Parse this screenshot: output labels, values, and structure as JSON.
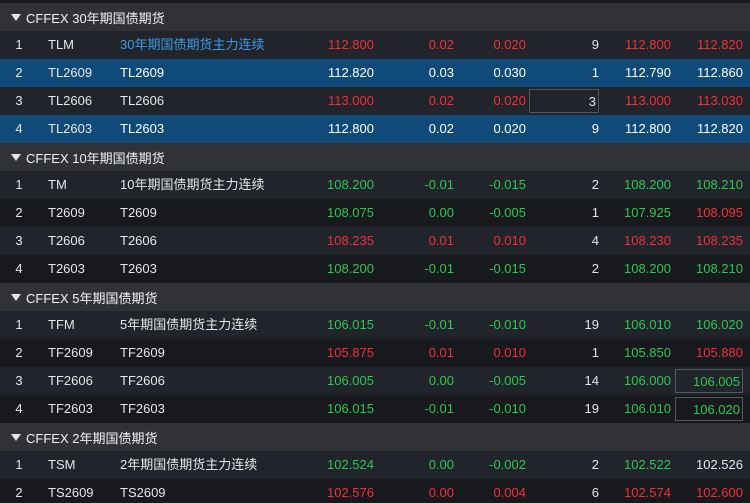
{
  "groups": [
    {
      "title": "CFFEX 30年期国债期货",
      "rows": [
        {
          "idx": "1",
          "code": "TLM",
          "name": "30年期国债期货主力连续",
          "last": "112.800",
          "chg": "0.02",
          "pct": "0.020",
          "vol": "9",
          "bid": "112.800",
          "ask": "112.820"
        },
        {
          "idx": "2",
          "code": "TL2609",
          "name": "TL2609",
          "last": "112.820",
          "chg": "0.03",
          "pct": "0.030",
          "vol": "1",
          "bid": "112.790",
          "ask": "112.860"
        },
        {
          "idx": "3",
          "code": "TL2606",
          "name": "TL2606",
          "last": "113.000",
          "chg": "0.02",
          "pct": "0.020",
          "vol": "3",
          "bid": "113.000",
          "ask": "113.030"
        },
        {
          "idx": "4",
          "code": "TL2603",
          "name": "TL2603",
          "last": "112.800",
          "chg": "0.02",
          "pct": "0.020",
          "vol": "9",
          "bid": "112.800",
          "ask": "112.820"
        }
      ]
    },
    {
      "title": "CFFEX 10年期国债期货",
      "rows": [
        {
          "idx": "1",
          "code": "TM",
          "name": "10年期国债期货主力连续",
          "last": "108.200",
          "chg": "-0.01",
          "pct": "-0.015",
          "vol": "2",
          "bid": "108.200",
          "ask": "108.210"
        },
        {
          "idx": "2",
          "code": "T2609",
          "name": "T2609",
          "last": "108.075",
          "chg": "0.00",
          "pct": "-0.005",
          "vol": "1",
          "bid": "107.925",
          "ask": "108.095"
        },
        {
          "idx": "3",
          "code": "T2606",
          "name": "T2606",
          "last": "108.235",
          "chg": "0.01",
          "pct": "0.010",
          "vol": "4",
          "bid": "108.230",
          "ask": "108.235"
        },
        {
          "idx": "4",
          "code": "T2603",
          "name": "T2603",
          "last": "108.200",
          "chg": "-0.01",
          "pct": "-0.015",
          "vol": "2",
          "bid": "108.200",
          "ask": "108.210"
        }
      ]
    },
    {
      "title": "CFFEX 5年期国债期货",
      "rows": [
        {
          "idx": "1",
          "code": "TFM",
          "name": "5年期国债期货主力连续",
          "last": "106.015",
          "chg": "-0.01",
          "pct": "-0.010",
          "vol": "19",
          "bid": "106.010",
          "ask": "106.020"
        },
        {
          "idx": "2",
          "code": "TF2609",
          "name": "TF2609",
          "last": "105.875",
          "chg": "0.01",
          "pct": "0.010",
          "vol": "1",
          "bid": "105.850",
          "ask": "105.880"
        },
        {
          "idx": "3",
          "code": "TF2606",
          "name": "TF2606",
          "last": "106.005",
          "chg": "0.00",
          "pct": "-0.005",
          "vol": "14",
          "bid": "106.000",
          "ask": "106.005"
        },
        {
          "idx": "4",
          "code": "TF2603",
          "name": "TF2603",
          "last": "106.015",
          "chg": "-0.01",
          "pct": "-0.010",
          "vol": "19",
          "bid": "106.010",
          "ask": "106.020"
        }
      ]
    },
    {
      "title": "CFFEX 2年期国债期货",
      "rows": [
        {
          "idx": "1",
          "code": "TSM",
          "name": "2年期国债期货主力连续",
          "last": "102.524",
          "chg": "0.00",
          "pct": "-0.002",
          "vol": "2",
          "bid": "102.522",
          "ask": "102.526"
        },
        {
          "idx": "2",
          "code": "TS2609",
          "name": "TS2609",
          "last": "102.576",
          "chg": "0.00",
          "pct": "0.004",
          "vol": "6",
          "bid": "102.574",
          "ask": "102.600"
        }
      ]
    }
  ],
  "styles": [
    [
      {
        "sel": false,
        "name": "link",
        "last": "up",
        "chg": "up",
        "pct": "up",
        "vol": "flat",
        "bid": "up",
        "ask": "up"
      },
      {
        "sel": true,
        "name": "flat",
        "last": "up",
        "chg": "up",
        "pct": "up",
        "vol": "flat",
        "bid": "flat",
        "ask": "up"
      },
      {
        "sel": false,
        "name": "flat",
        "last": "up",
        "chg": "up",
        "pct": "up",
        "vol": "flat",
        "bid": "up",
        "ask": "up",
        "boxed": "vol"
      },
      {
        "sel": true,
        "name": "flat",
        "last": "flat",
        "chg": "flat",
        "pct": "flat",
        "vol": "flat",
        "bid": "flat",
        "ask": "flat"
      }
    ],
    [
      {
        "sel": false,
        "name": "flat",
        "last": "down",
        "chg": "down",
        "pct": "down",
        "vol": "flat",
        "bid": "down",
        "ask": "down"
      },
      {
        "sel": false,
        "name": "flat",
        "last": "down",
        "chg": "down",
        "pct": "down",
        "vol": "flat",
        "bid": "down",
        "ask": "up"
      },
      {
        "sel": false,
        "name": "flat",
        "last": "up",
        "chg": "up",
        "pct": "up",
        "vol": "flat",
        "bid": "up",
        "ask": "up"
      },
      {
        "sel": false,
        "name": "flat",
        "last": "down",
        "chg": "down",
        "pct": "down",
        "vol": "flat",
        "bid": "down",
        "ask": "down"
      }
    ],
    [
      {
        "sel": false,
        "name": "flat",
        "last": "down",
        "chg": "down",
        "pct": "down",
        "vol": "flat",
        "bid": "down",
        "ask": "down"
      },
      {
        "sel": false,
        "name": "flat",
        "last": "up",
        "chg": "up",
        "pct": "up",
        "vol": "flat",
        "bid": "down",
        "ask": "up"
      },
      {
        "sel": false,
        "name": "flat",
        "last": "down",
        "chg": "down",
        "pct": "down",
        "vol": "flat",
        "bid": "down",
        "ask": "down",
        "boxed": "ask"
      },
      {
        "sel": false,
        "name": "flat",
        "last": "down",
        "chg": "down",
        "pct": "down",
        "vol": "flat",
        "bid": "down",
        "ask": "down",
        "boxed": "ask"
      }
    ],
    [
      {
        "sel": false,
        "name": "flat",
        "last": "down",
        "chg": "down",
        "pct": "down",
        "vol": "flat",
        "bid": "down",
        "ask": "flat"
      },
      {
        "sel": false,
        "name": "flat",
        "last": "up",
        "chg": "up",
        "pct": "up",
        "vol": "flat",
        "bid": "up",
        "ask": "up"
      }
    ]
  ]
}
